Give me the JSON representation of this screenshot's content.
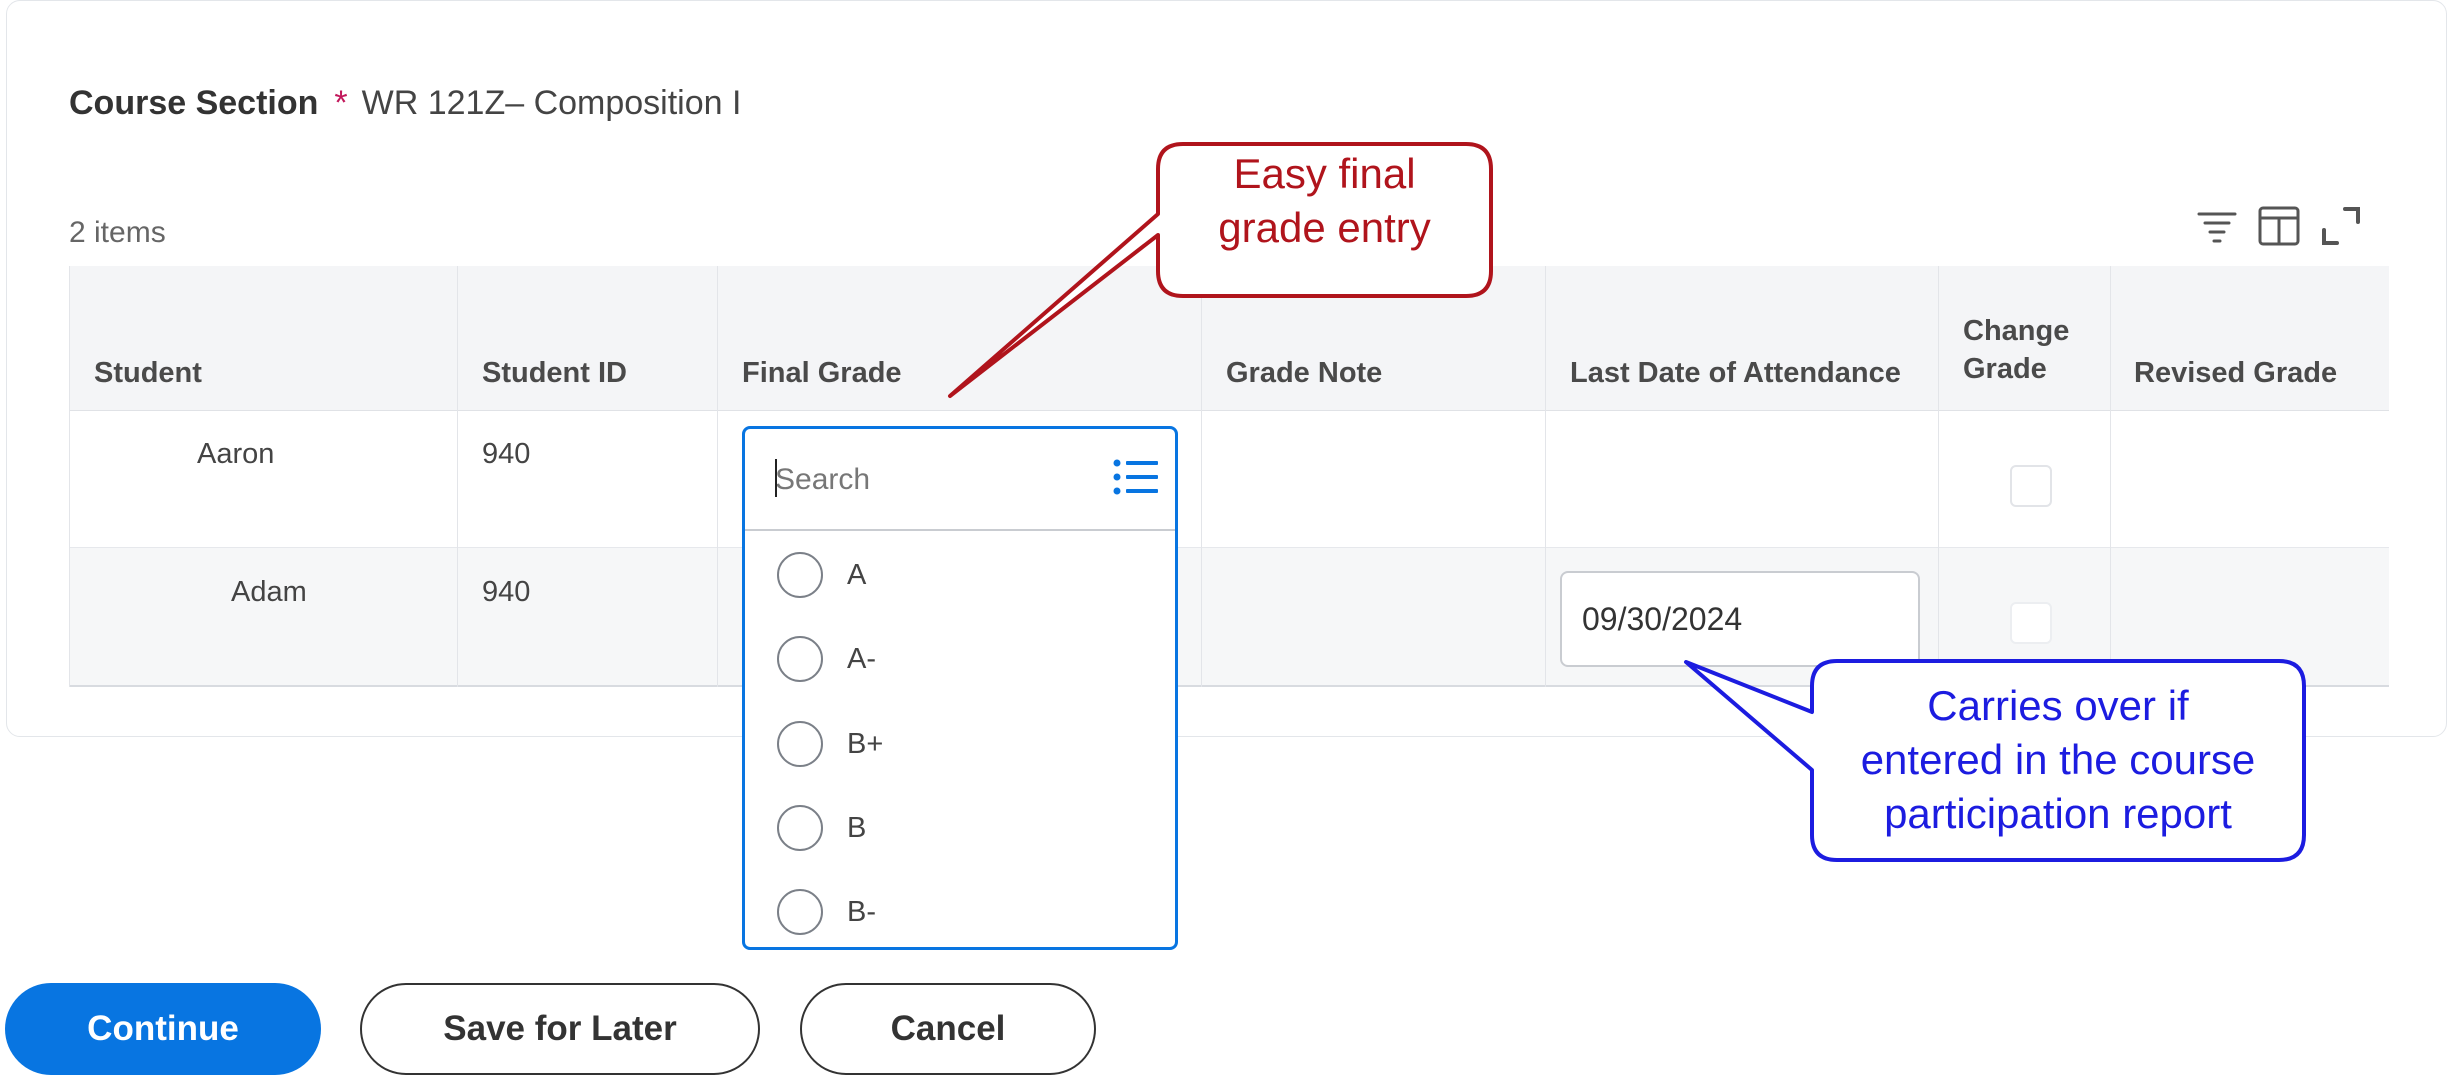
{
  "form": {
    "section_label": "Course Section",
    "required_mark": "*",
    "section_value": "WR 121Z– Composition I",
    "items_count": "2 items"
  },
  "toolbar": {
    "icons": [
      "filter-icon",
      "column-chooser-icon",
      "fullscreen-icon"
    ]
  },
  "table": {
    "headers": {
      "student": "Student",
      "student_id": "Student ID",
      "final_grade": "Final Grade",
      "grade_note": "Grade Note",
      "last_date": "Last Date of Attendance",
      "change_grade_1": "Change",
      "change_grade_2": "Grade",
      "revised_grade": "Revised Grade"
    },
    "rows": [
      {
        "student": "Aaron",
        "student_id": "940",
        "last_date": ""
      },
      {
        "student": "Adam",
        "student_id": "940",
        "last_date": "09/30/2024"
      }
    ]
  },
  "dropdown": {
    "placeholder": "Search",
    "options": [
      "A",
      "A-",
      "B+",
      "B",
      "B-"
    ]
  },
  "buttons": {
    "continue": "Continue",
    "save_for_later": "Save for Later",
    "cancel": "Cancel"
  },
  "callouts": {
    "final_grade_line1": "Easy final",
    "final_grade_line2": "grade entry",
    "attendance_line1": "Carries over if",
    "attendance_line2": "entered in the course",
    "attendance_line3": "participation report"
  },
  "colors": {
    "accent": "#0875e1",
    "required": "#c2185b",
    "callout_red": "#b0141c",
    "callout_blue": "#1c1ce0"
  }
}
